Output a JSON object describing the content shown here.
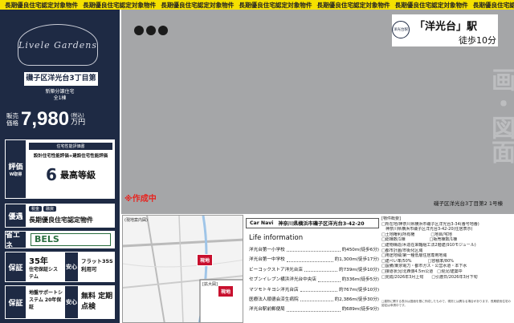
{
  "banner": {
    "text": "長期優良住宅認定対象物件",
    "repeat": 7
  },
  "left": {
    "logo_text": "Livele Gardens",
    "property_name": "磯子区洋光台3丁目第2",
    "type_line1": "新築分譲住宅",
    "type_line2": "全1棟",
    "price": {
      "label": "販売価格",
      "value": "7,980",
      "tax_note": "(税込)",
      "unit": "万円"
    },
    "eval": {
      "tag": "評価",
      "sub": "W取得",
      "line1": "住宅性能評価書",
      "line2": "設計住宅性能評価+建設住宅性能評価",
      "grade_num": "6",
      "grade_text": "最高等級"
    },
    "yusen": {
      "tag": "優遇",
      "badges": [
        "税金",
        "融資"
      ],
      "text": "長期優良住宅認定物件"
    },
    "shoene": {
      "tag": "省エネ",
      "text": "BELS"
    },
    "hosho1": {
      "tag": "保証",
      "years": "35年",
      "text": "住宅保証システム",
      "tag2": "安心",
      "flat": "フラット35S 利用可"
    },
    "hosho2": {
      "tag": "保証",
      "years": "20年",
      "text": "地盤サポートシステム 20年保証",
      "tag2": "安心",
      "free": "無料 定期点検"
    }
  },
  "main": {
    "station_name": "「洋光台」駅",
    "station_badge": "洋光台駅",
    "walk": "徒歩10分",
    "vertical_text": "画・図面",
    "making": "※作成中",
    "caption": "磯子区洋光台3丁目第2 1号棟"
  },
  "map": {
    "label1": "(現地案内図)",
    "label2": "[拡大図]",
    "pin": "現地"
  },
  "car_navi": {
    "label": "Car Navi",
    "address": "神奈川県横浜市磯子区洋光台3-42-20"
  },
  "life": {
    "title": "Life information",
    "items": [
      {
        "name": "洋光台第一小学校",
        "dist": "約450m(徒歩6分)"
      },
      {
        "name": "洋光台第一中学校",
        "dist": "約1,300m(徒歩17分)"
      },
      {
        "name": "ビーコックストア洋光台店",
        "dist": "約739m(徒歩10分)"
      },
      {
        "name": "セブンイレブン横浜洋光台中央店",
        "dist": "約336m(徒歩5分)"
      },
      {
        "name": "マツモトキヨシ洋光台店",
        "dist": "約767m(徒歩10分)"
      },
      {
        "name": "医療法人順德会済生病院",
        "dist": "約2,386m(徒歩30分)"
      },
      {
        "name": "洋光台駅前郵便局",
        "dist": "約689m(徒歩9分)"
      }
    ]
  },
  "spec": {
    "title": "[物件概要]",
    "lines": [
      "□所在地/神奈川県横浜市磯子区洋光台3-34(番号地番)",
      "　神奈川県横浜市磯子区洋光台3-42-20(住居表示)",
      "□土地権利/所有権　　　　□地目/宅地",
      "□総棟数/1棟　　　　　　□販売棟数/1棟",
      "□建物構造/木造在来軸組工法2階建(910モジュール)",
      "□都市計画/市街化区域",
      "□用途地域/第一種低層住居専用地域",
      "□建ぺい率/50%　　　　□容積率/80%",
      "□設備/東京電力・都市ガス・公営水道・本下水",
      "□接道状況/北西側4.5m公道　□現況/建築中",
      "□完成/2026年3月上旬　　□引渡日/2026年3月下旬"
    ],
    "notes": "□建物に関する表示は図面を基に作成したもので、現況とは異なる場合があります。長期優良住宅の認定は申請中です。"
  }
}
